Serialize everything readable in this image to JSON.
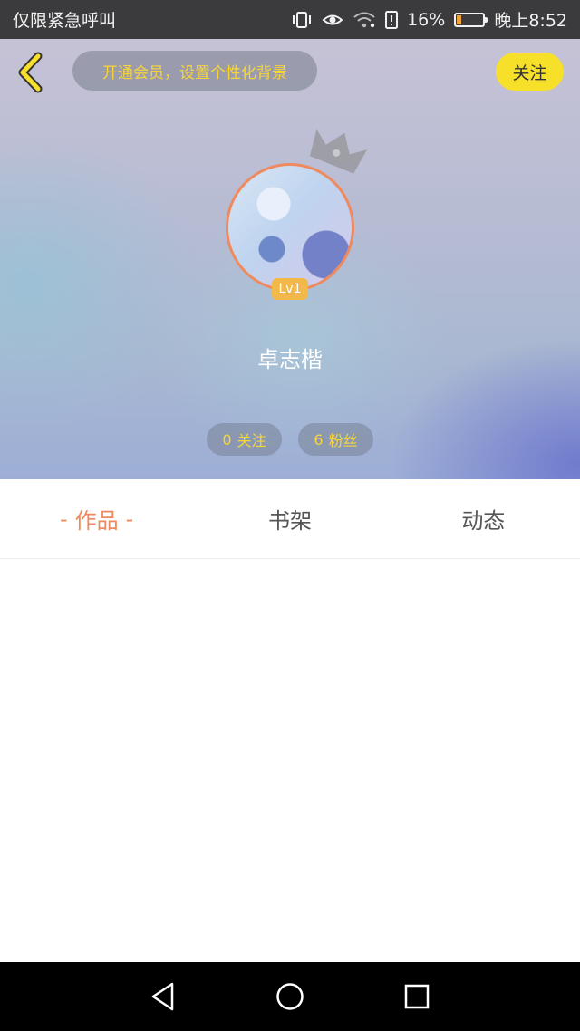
{
  "status_bar": {
    "left_text": "仅限紧急呼叫",
    "battery_percent": "16%",
    "time": "晚上8:52",
    "icons": [
      "vibrate-icon",
      "eye-icon",
      "wifi-icon",
      "alert-icon",
      "battery-icon"
    ],
    "battery_level": 0.16
  },
  "header": {
    "back_icon": "back-chevron-icon",
    "vip_promo": "开通会员，设置个性化背景",
    "follow_label": "关注"
  },
  "profile": {
    "level": "Lv1",
    "username": "卓志楷",
    "following": {
      "count": "0",
      "label": "关注"
    },
    "fans": {
      "count": "6",
      "label": "粉丝"
    }
  },
  "tabs": [
    {
      "label": "作品",
      "active": true,
      "deco": "-"
    },
    {
      "label": "书架",
      "active": false
    },
    {
      "label": "动态",
      "active": false
    }
  ],
  "nav_bar": {
    "icons": [
      "back-triangle-icon",
      "home-circle-icon",
      "recents-square-icon"
    ]
  },
  "colors": {
    "accent_orange": "#ef8a5e",
    "accent_yellow": "#f7e02a",
    "promo_text": "#f7d53a"
  }
}
